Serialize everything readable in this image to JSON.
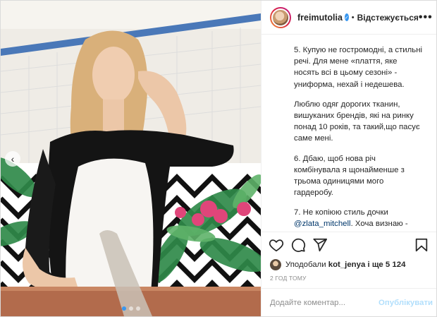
{
  "header": {
    "username": "freimutolia",
    "separator": "•",
    "follow_status": "Відстежується",
    "more_label": "•••"
  },
  "caption": {
    "paragraphs": [
      "5. Купую не гостромодні, а стильні речі. Для мене «плаття, яке носять всі в цьому сезоні» - униформа, нехай і недешева.",
      "Люблю одяг дорогих тканин, вишуканих брендів, які на ринку понад 10 років, та такий,що пасує саме мені.",
      "6. Дбаю, щоб нова річ комбінувала я щонайменше з трьома одиницями мого гардеробу."
    ],
    "p7_start": "7. Не копіюю стиль дочки",
    "p7_mention": "@zlata_mitchell",
    "p7_end": ". Хоча визнаю - Злата модна дівчина. Нема нічого гіршого, ніж п'яна жінка, або та, яка молодиться."
  },
  "actions": {
    "like_icon": "heart-icon",
    "comment_icon": "comment-icon",
    "share_icon": "share-icon",
    "save_icon": "bookmark-icon"
  },
  "likes": {
    "prefix": "Уподобали",
    "user": "kot_jenya",
    "suffix": "і ще 5 124"
  },
  "timestamp": "2 ГОД ТОМУ",
  "comment": {
    "placeholder": "Додайте коментар...",
    "publish_label": "Опублікувати"
  },
  "carousel": {
    "total": 3,
    "current": 1
  },
  "colors": {
    "accent": "#3897f0",
    "publish_disabled": "#b2dffc",
    "link": "#00376b",
    "muted": "#8e8e8e"
  }
}
